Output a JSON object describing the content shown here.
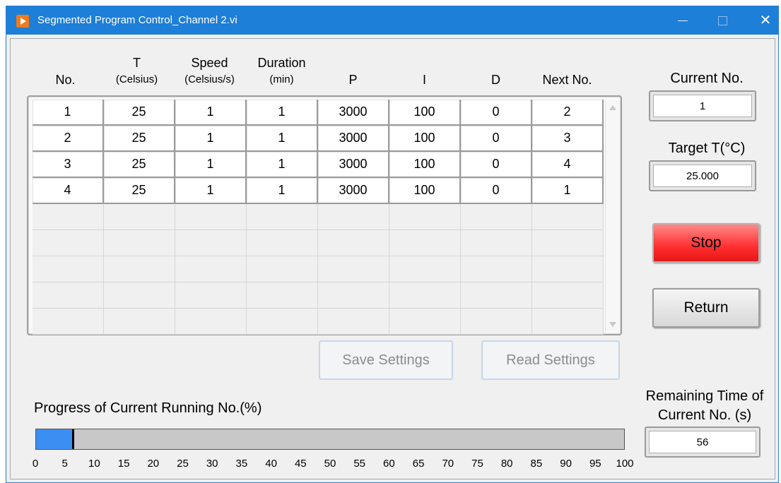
{
  "window": {
    "title": "Segmented Program Control_Channel 2.vi",
    "close_glyph": "✕"
  },
  "table": {
    "headers": [
      {
        "main": "No.",
        "sub": ""
      },
      {
        "main": "T",
        "sub": "(Celsius)"
      },
      {
        "main": "Speed",
        "sub": "(Celsius/s)"
      },
      {
        "main": "Duration",
        "sub": "(min)"
      },
      {
        "main": "P",
        "sub": ""
      },
      {
        "main": "I",
        "sub": ""
      },
      {
        "main": "D",
        "sub": ""
      },
      {
        "main": "Next No.",
        "sub": ""
      }
    ],
    "rows": [
      [
        "1",
        "25",
        "1",
        "1",
        "3000",
        "100",
        "0",
        "2"
      ],
      [
        "2",
        "25",
        "1",
        "1",
        "3000",
        "100",
        "0",
        "3"
      ],
      [
        "3",
        "25",
        "1",
        "1",
        "3000",
        "100",
        "0",
        "4"
      ],
      [
        "4",
        "25",
        "1",
        "1",
        "3000",
        "100",
        "0",
        "1"
      ]
    ],
    "empty_rows": 5
  },
  "buttons": {
    "save_settings": "Save Settings",
    "read_settings": "Read Settings",
    "stop": "Stop",
    "return": "Return"
  },
  "indicators": {
    "current_no_label": "Current No.",
    "current_no_value": "1",
    "target_t_label": "Target T(°C)",
    "target_t_value": "25.000",
    "remaining_label_line1": "Remaining Time of",
    "remaining_label_line2": "Current No. (s)",
    "remaining_value": "56"
  },
  "progress": {
    "label": "Progress of Current Running No.(%)",
    "value_percent": 6.5,
    "ticks": [
      "0",
      "5",
      "10",
      "15",
      "20",
      "25",
      "30",
      "35",
      "40",
      "45",
      "50",
      "55",
      "60",
      "65",
      "70",
      "75",
      "80",
      "85",
      "90",
      "95",
      "100"
    ]
  },
  "colors": {
    "titlebar": "#1e7fd8",
    "progress_fill": "#3b8ef2",
    "stop_button": "#ff3030"
  }
}
